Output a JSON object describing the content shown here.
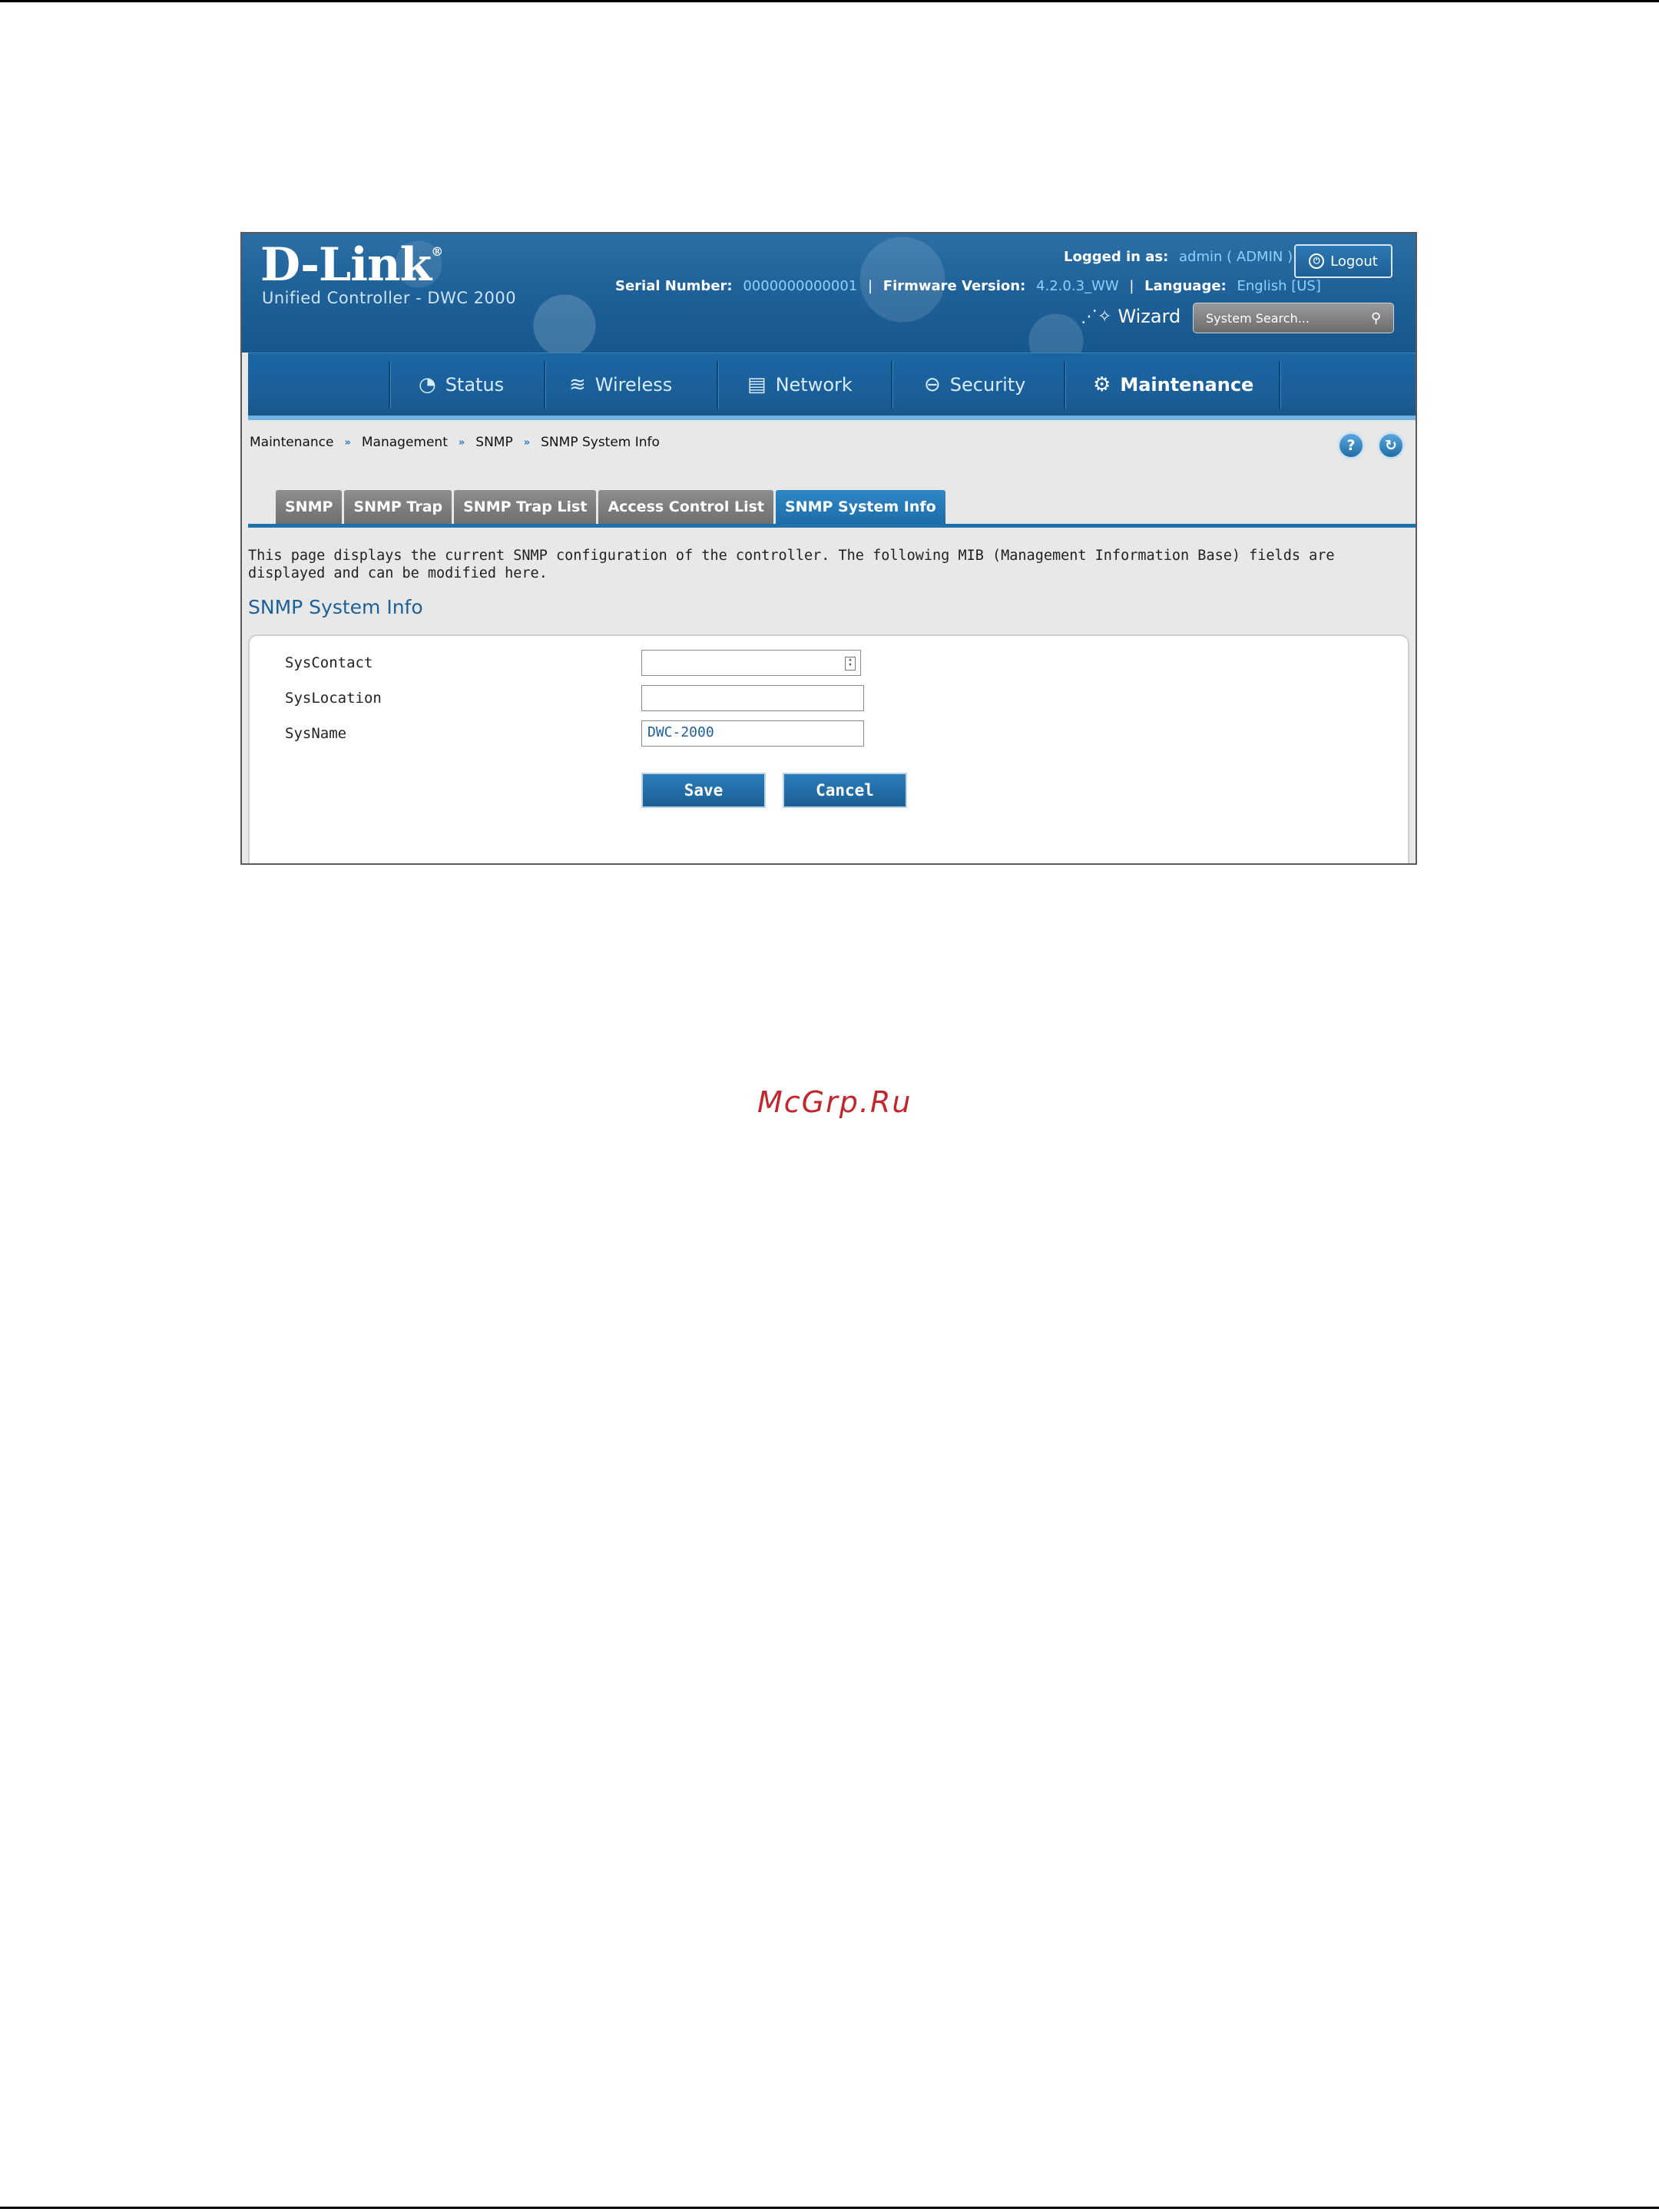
{
  "header": {
    "logo": "D-Link",
    "logo_mark": "®",
    "product": "Unified Controller - DWC 2000",
    "logged_in_label": "Logged in as:",
    "logged_in_user": "admin ( ADMIN )",
    "logout_label": "Logout",
    "serial_label": "Serial Number:",
    "serial_value": "0000000000001",
    "firmware_label": "Firmware Version:",
    "firmware_value": "4.2.0.3_WW",
    "language_label": "Language:",
    "language_value": "English [US]",
    "wizard_label": "Wizard",
    "search_placeholder": "System Search..."
  },
  "nav": {
    "items": [
      {
        "label": "Status",
        "icon": "gauge-icon"
      },
      {
        "label": "Wireless",
        "icon": "wifi-icon"
      },
      {
        "label": "Network",
        "icon": "computer-icon"
      },
      {
        "label": "Security",
        "icon": "lock-icon"
      },
      {
        "label": "Maintenance",
        "icon": "gears-icon",
        "active": true
      }
    ]
  },
  "breadcrumb": [
    "Maintenance",
    "Management",
    "SNMP",
    "SNMP System Info"
  ],
  "tabs": [
    {
      "label": "SNMP"
    },
    {
      "label": "SNMP Trap"
    },
    {
      "label": "SNMP Trap List"
    },
    {
      "label": "Access Control List"
    },
    {
      "label": "SNMP System Info",
      "active": true
    }
  ],
  "description": "This page displays the current SNMP configuration of the controller. The following MIB (Management Information Base) fields are displayed and can be modified here.",
  "section_title": "SNMP System Info",
  "form": {
    "syscontact_label": "SysContact",
    "syscontact_value": "",
    "syslocation_label": "SysLocation",
    "syslocation_value": "",
    "sysname_label": "SysName",
    "sysname_value": "DWC-2000",
    "save_label": "Save",
    "cancel_label": "Cancel"
  },
  "watermark": "McGrp.Ru",
  "colors": {
    "brand_blue": "#1d5f97",
    "accent_light": "#8fd0ff",
    "watermark_red": "#c1272d"
  }
}
